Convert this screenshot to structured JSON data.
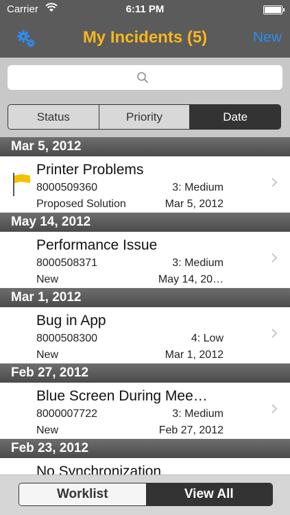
{
  "status_bar": {
    "carrier": "Carrier",
    "time": "6:11 PM"
  },
  "nav": {
    "title": "My Incidents (5)",
    "new_label": "New"
  },
  "search": {
    "placeholder": ""
  },
  "sort_segments": [
    "Status",
    "Priority",
    "Date"
  ],
  "sort_selected": "Date",
  "sections": [
    {
      "header": "Mar 5, 2012",
      "item": {
        "title": "Printer Problems",
        "id": "8000509360",
        "priority": "3: Medium",
        "status": "Proposed Solution",
        "date": "Mar 5, 2012",
        "flagged": true
      }
    },
    {
      "header": "May 14, 2012",
      "item": {
        "title": "Performance Issue",
        "id": "8000508371",
        "priority": "3: Medium",
        "status": "New",
        "date": "May 14, 20…",
        "flagged": false
      }
    },
    {
      "header": "Mar 1, 2012",
      "item": {
        "title": "Bug in App",
        "id": "8000508300",
        "priority": "4: Low",
        "status": "New",
        "date": "Mar 1, 2012",
        "flagged": false
      }
    },
    {
      "header": "Feb 27, 2012",
      "item": {
        "title": "Blue Screen During Mee…",
        "id": "8000007722",
        "priority": "3: Medium",
        "status": "New",
        "date": "Feb 27, 2012",
        "flagged": false
      }
    },
    {
      "header": "Feb 23, 2012",
      "item": {
        "title": "No Synchronization",
        "id": "",
        "priority": "",
        "status": "",
        "date": "",
        "flagged": false
      }
    }
  ],
  "bottom_tabs": {
    "worklist": "Worklist",
    "view_all": "View All",
    "selected": "View All"
  },
  "colors": {
    "nav_title": "#f5b81e",
    "accent": "#2c8cf0",
    "flag": "#f5c000"
  }
}
